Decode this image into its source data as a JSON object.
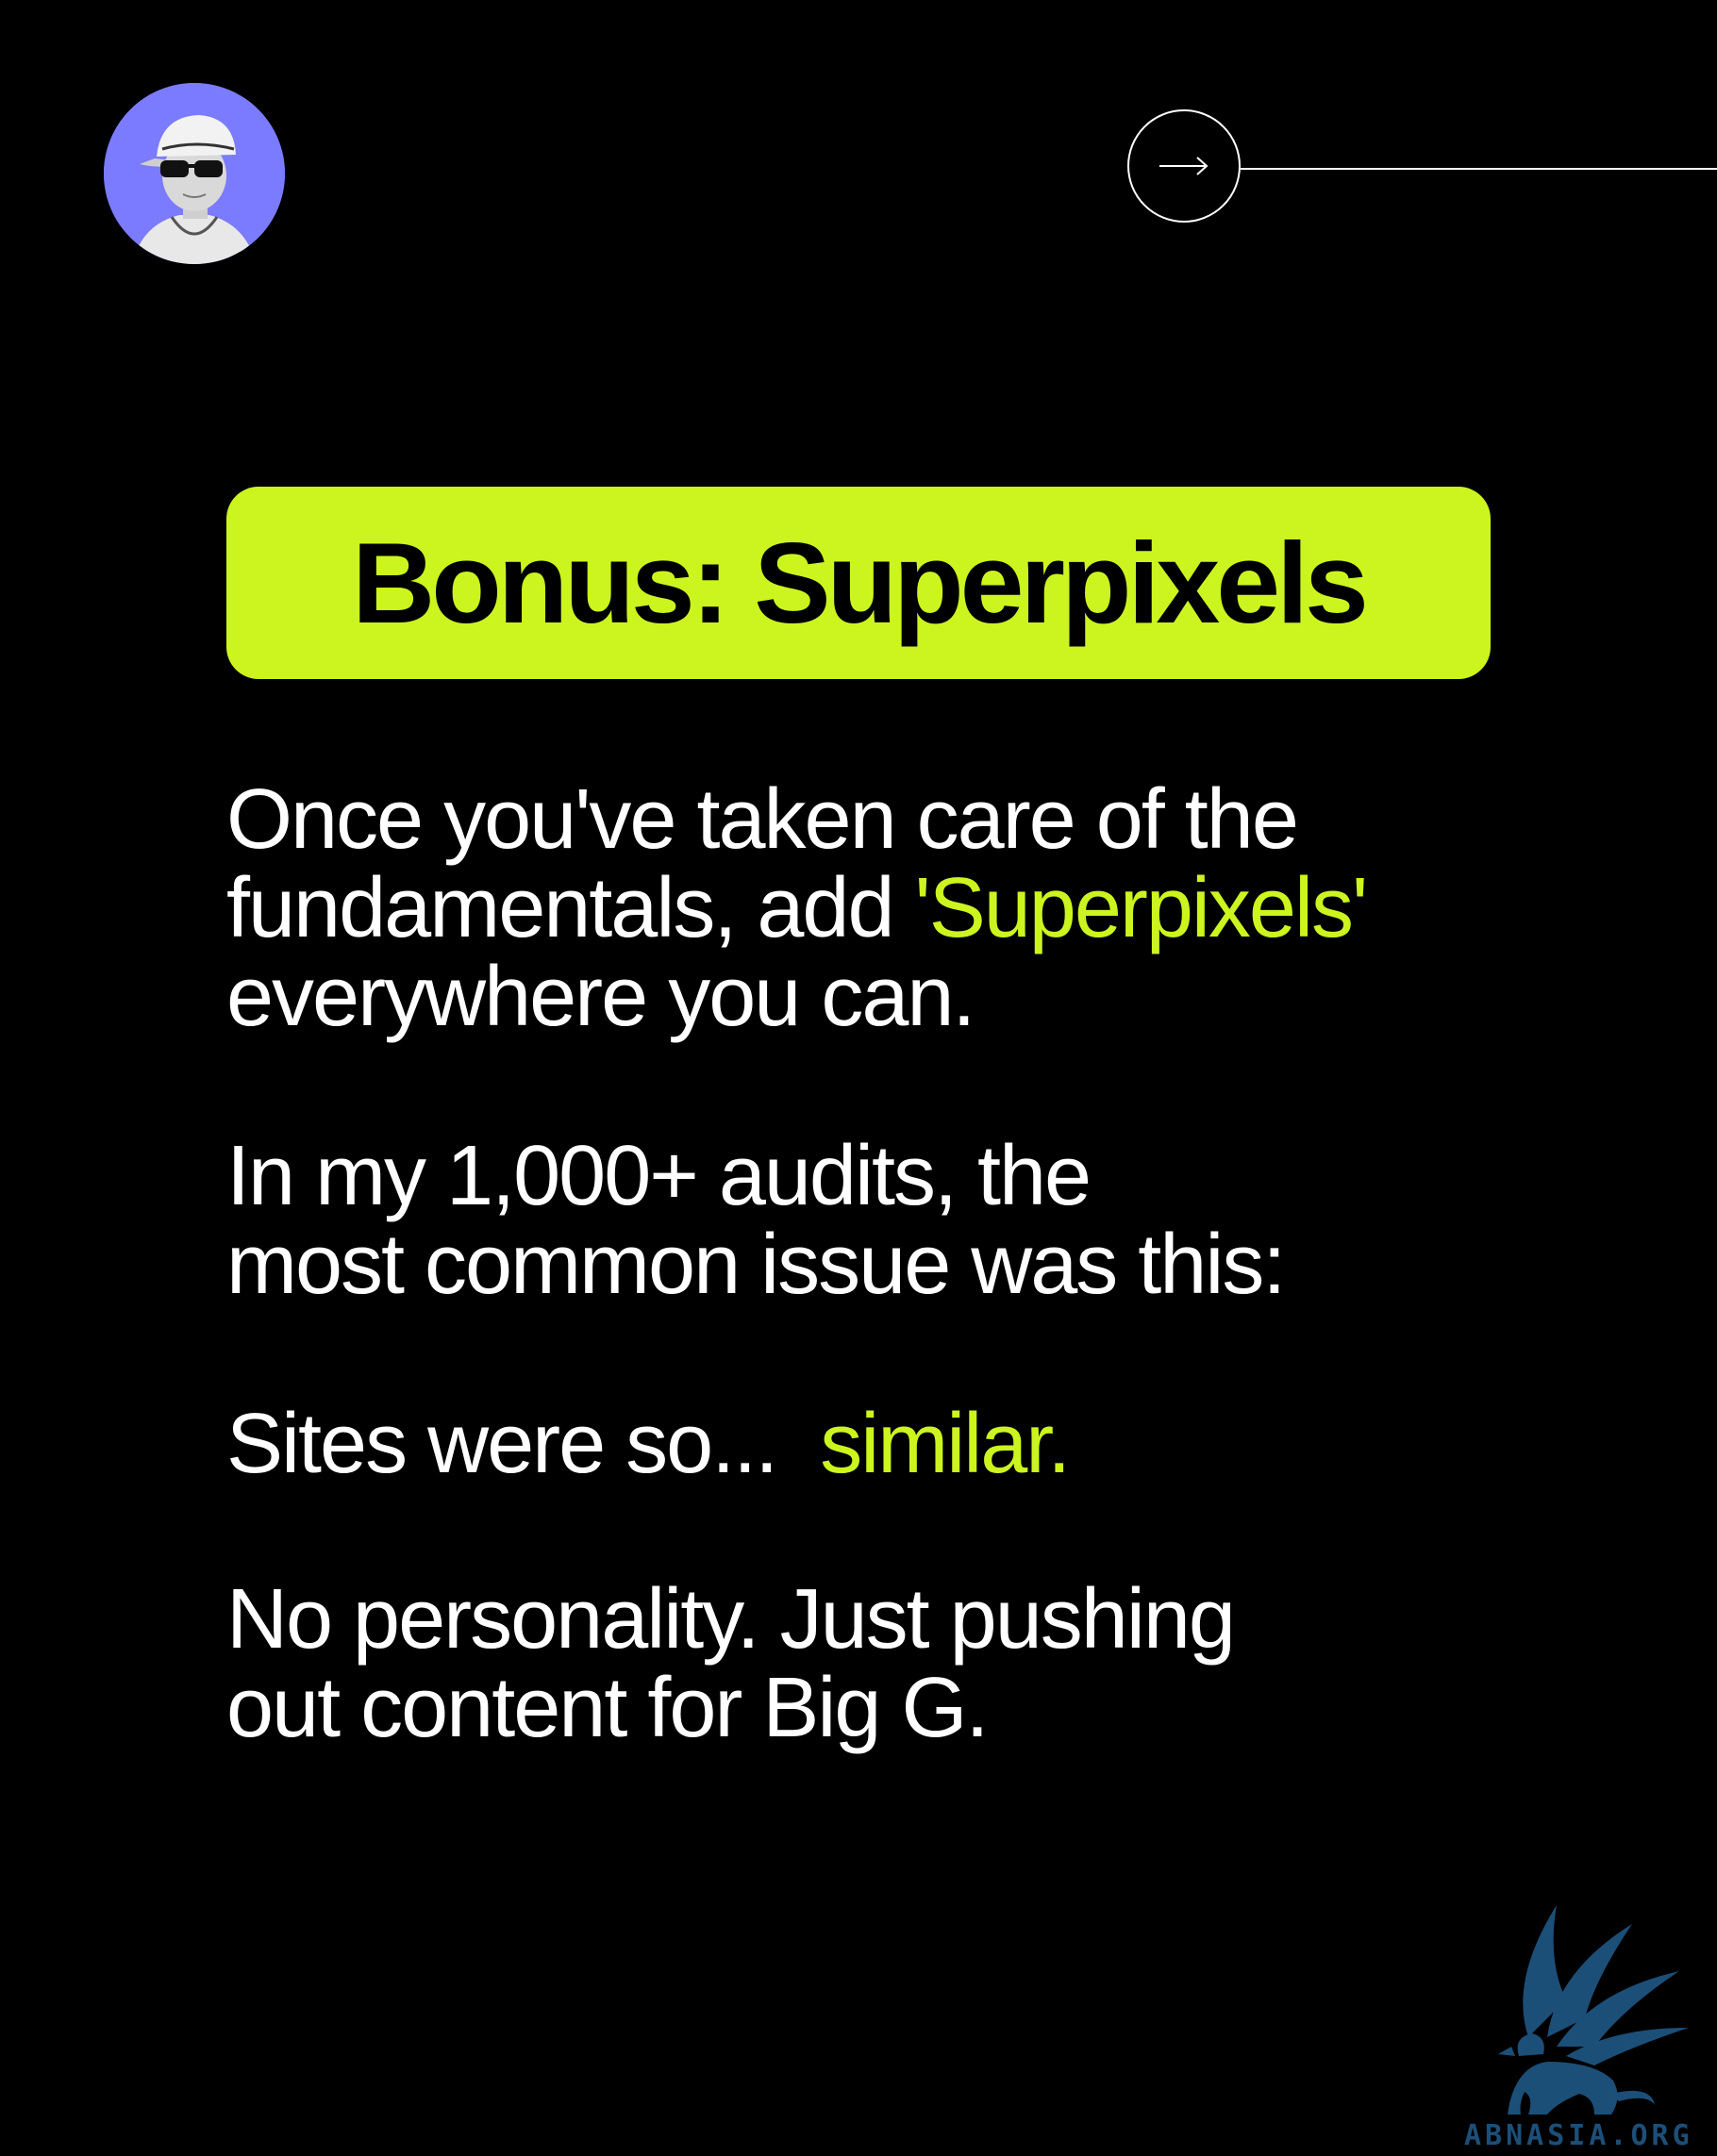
{
  "colors": {
    "background": "#000000",
    "accent": "#ccf51f",
    "avatar_bg": "#7b7bff",
    "watermark": "#1c4f78"
  },
  "header": {
    "avatar_icon": "profile-photo",
    "next_icon": "arrow-right-icon"
  },
  "title": "Bonus: Superpixels",
  "paragraphs": {
    "p1": {
      "line1": "Once  you've taken care of the",
      "line2_pre": "fundamentals, add ",
      "line2_highlight": "'Superpixels'",
      "line3": "everywhere  you can."
    },
    "p2": {
      "line1": "In my 1,000+ audits, the",
      "line2": "most common issue was this:"
    },
    "p3": {
      "pre": "Sites were so...  ",
      "highlight": "similar."
    },
    "p4": {
      "line1": "No personality. Just pushing",
      "line2": "out content for Big G."
    }
  },
  "watermark": {
    "text": "ABNASIA.ORG",
    "icon": "griffin-logo"
  }
}
